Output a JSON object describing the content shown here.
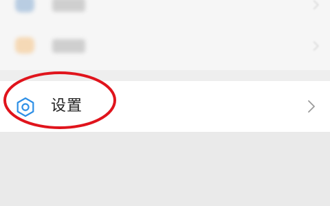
{
  "settings_item": {
    "label": "设置"
  },
  "icons": {
    "settings": "gear-icon",
    "chevron": "chevron-right-icon"
  },
  "colors": {
    "accent": "#2d8fe6",
    "annotation": "#e0141c"
  }
}
